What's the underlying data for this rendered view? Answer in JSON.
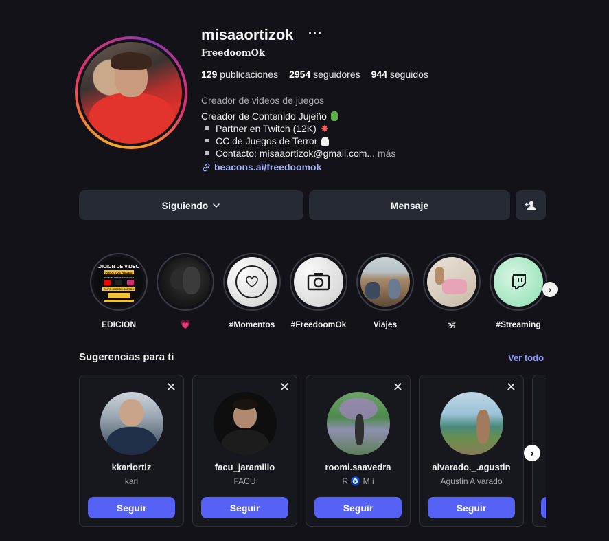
{
  "profile": {
    "username": "misaaortizok",
    "more_icon": "more-horizontal-icon",
    "full_name": "FreedoomOk",
    "stats": {
      "posts_count": "129",
      "posts_label": "publicaciones",
      "followers_count": "2954",
      "followers_label": "seguidores",
      "following_count": "944",
      "following_label": "seguidos"
    },
    "category": "Creador de videos de juegos",
    "bio": {
      "line1": "Creador de Contenido Jujeño",
      "line2": "Partner en Twitch (12K)",
      "line3": "CC de Juegos de Terror",
      "line4": "Contacto: misaaortizok@gmail.com...",
      "more": "más"
    },
    "link": "beacons.ai/freedoomok",
    "link_color": "#a5b4fc"
  },
  "actions": {
    "following_label": "Siguiendo",
    "message_label": "Mensaje",
    "add_user_icon": "add-user-icon"
  },
  "highlights": [
    {
      "label": "EDICION"
    },
    {
      "label": "💗"
    },
    {
      "label": "#Momentos"
    },
    {
      "label": "#FreedoomOk"
    },
    {
      "label": "Viajes"
    },
    {
      "label": "🕉"
    },
    {
      "label": "#Streaming"
    }
  ],
  "edicion_cover": {
    "title": "EDICION DE VIDEOS",
    "subtitle": "PARA TUS REDES",
    "icons_row": "YOUTUBE TIKTOK INSTAGRAM",
    "small_text": "CLIPS - VIDEOS CORTOS"
  },
  "suggestions": {
    "title": "Sugerencias para ti",
    "see_all": "Ver todo",
    "cards": [
      {
        "username": "kkariortiz",
        "subtitle": "kari",
        "button": "Seguir"
      },
      {
        "username": "facu_jaramillo",
        "subtitle": "FACU",
        "button": "Seguir"
      },
      {
        "username": "roomi.saavedra",
        "subtitle": "R 🧿 M i",
        "button": "Seguir"
      },
      {
        "username": "alvarado._.agustin",
        "subtitle": "Agustin Alvarado",
        "button": "Seguir"
      }
    ]
  },
  "colors": {
    "background": "#121218",
    "button_bg": "#262a33",
    "follow_button": "#5662f6",
    "see_all": "#8e9bf7",
    "ring_gradient": [
      "#f9a825",
      "#e1306c",
      "#833ab4"
    ]
  }
}
